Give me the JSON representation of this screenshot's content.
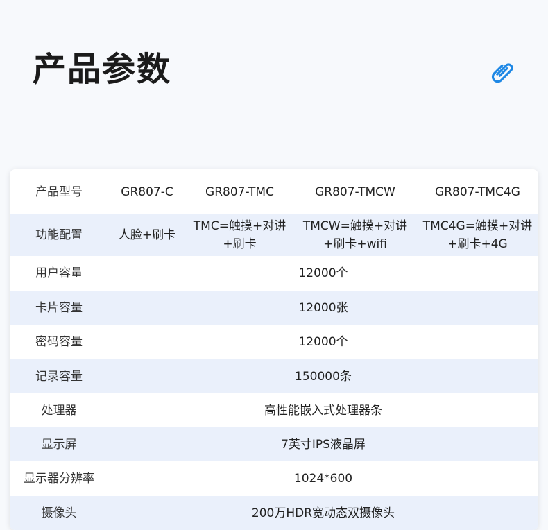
{
  "title": "产品参数",
  "header_row": {
    "label": "产品型号",
    "models": [
      "GR807-C",
      "GR807-TMC",
      "GR807-TMCW",
      "GR807-TMC4G"
    ]
  },
  "feature_row": {
    "label": "功能配置",
    "values": [
      {
        "line1": "人脸+刷卡",
        "line2": ""
      },
      {
        "line1": "TMC=触摸+对讲",
        "line2": "+刷卡"
      },
      {
        "line1": "TMCW=触摸+对讲",
        "line2": "+刷卡+wifi"
      },
      {
        "line1": "TMC4G=触摸+对讲",
        "line2": "+刷卡+4G"
      }
    ]
  },
  "spec_rows": [
    {
      "label": "用户容量",
      "value": "12000个"
    },
    {
      "label": "卡片容量",
      "value": "12000张"
    },
    {
      "label": "密码容量",
      "value": "12000个"
    },
    {
      "label": "记录容量",
      "value": "150000条"
    },
    {
      "label": "处理器",
      "value": "高性能嵌入式处理器条"
    },
    {
      "label": "显示屏",
      "value": "7英寸IPS液晶屏"
    },
    {
      "label": "显示器分辨率",
      "value": "1024*600"
    },
    {
      "label": "摄像头",
      "value": "200万HDR宽动态双摄像头"
    }
  ],
  "icons": {
    "clip": "paperclip-icon"
  },
  "colors": {
    "accent": "#1e88e5",
    "row_alt": "#eaf0fb"
  }
}
